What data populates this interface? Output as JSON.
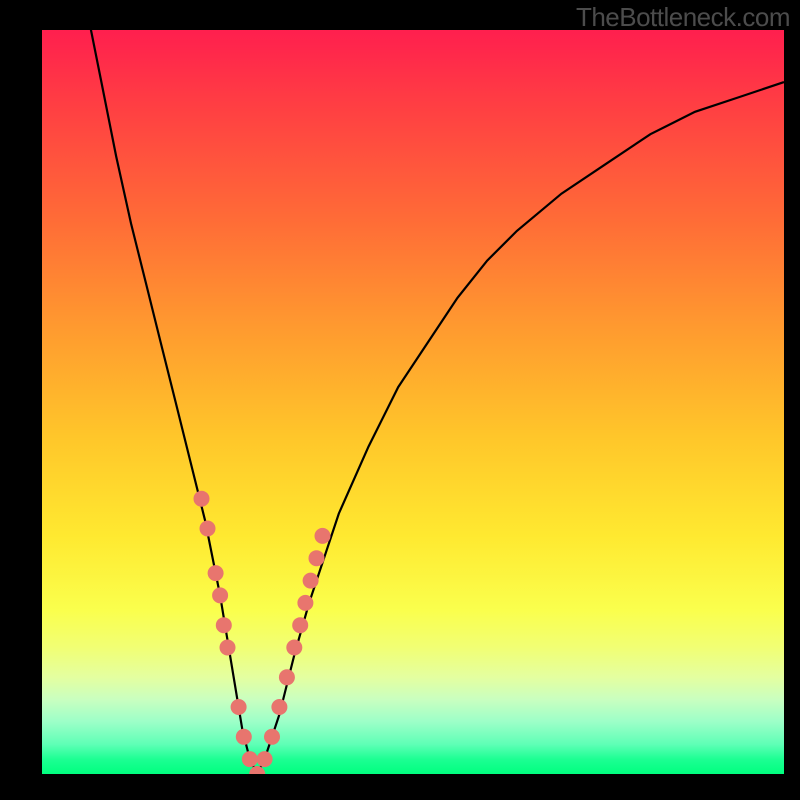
{
  "watermark": "TheBottleneck.com",
  "colors": {
    "frame": "#000000",
    "curve": "#000000",
    "dots": "#e8756e",
    "gradient_top": "#ff1f4e",
    "gradient_bottom": "#00ff7f"
  },
  "chart_data": {
    "type": "line",
    "title": "",
    "xlabel": "",
    "ylabel": "",
    "xlim": [
      0,
      100
    ],
    "ylim": [
      0,
      100
    ],
    "series": [
      {
        "name": "bottleneck-curve",
        "x": [
          6,
          8,
          10,
          12,
          14,
          16,
          18,
          20,
          22,
          24,
          25,
          26,
          27,
          28,
          29,
          30,
          32,
          34,
          36,
          38,
          40,
          44,
          48,
          52,
          56,
          60,
          64,
          70,
          76,
          82,
          88,
          94,
          100
        ],
        "values": [
          103,
          93,
          83,
          74,
          66,
          58,
          50,
          42,
          34,
          24,
          18,
          12,
          6,
          2,
          0,
          2,
          8,
          16,
          23,
          29,
          35,
          44,
          52,
          58,
          64,
          69,
          73,
          78,
          82,
          86,
          89,
          91,
          93
        ]
      }
    ],
    "markers": {
      "name": "highlighted-points",
      "x": [
        21.5,
        22.3,
        23.4,
        24.0,
        24.5,
        25.0,
        26.5,
        27.2,
        28.0,
        29.0,
        30.0,
        31.0,
        32.0,
        33.0,
        34.0,
        34.8,
        35.5,
        36.2,
        37.0,
        37.8
      ],
      "values": [
        37,
        33,
        27,
        24,
        20,
        17,
        9,
        5,
        2,
        0,
        2,
        5,
        9,
        13,
        17,
        20,
        23,
        26,
        29,
        32
      ]
    }
  }
}
